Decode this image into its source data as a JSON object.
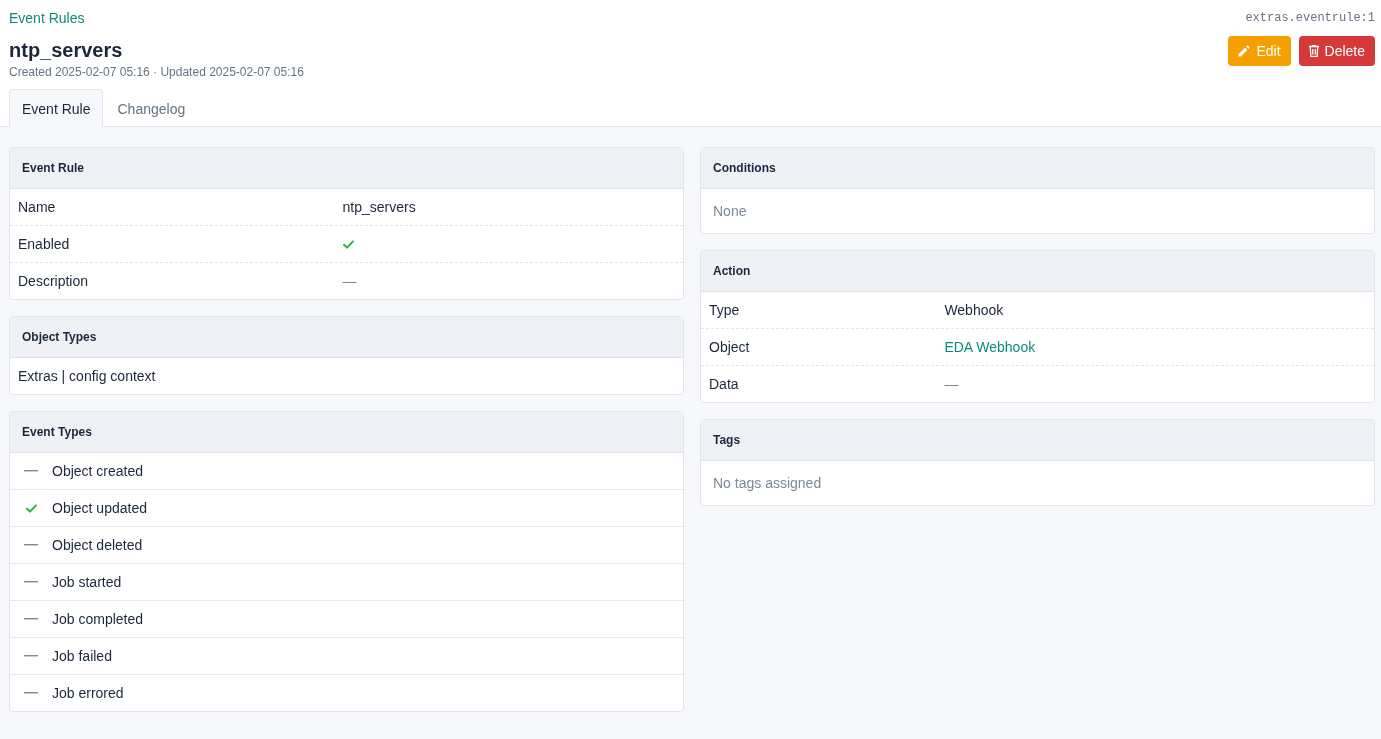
{
  "breadcrumb": {
    "label": "Event Rules"
  },
  "object_id": "extras.eventrule:1",
  "title": "ntp_servers",
  "subtitle": "Created 2025-02-07 05:16 · Updated 2025-02-07 05:16",
  "buttons": [
    {
      "label": "Edit",
      "kind": "edit"
    },
    {
      "label": "Delete",
      "kind": "delete"
    }
  ],
  "tabs": [
    {
      "label": "Event Rule",
      "selected": true
    },
    {
      "label": "Changelog",
      "selected": false
    }
  ],
  "columns": [
    {
      "cards": [
        {
          "title": "Event Rule",
          "kind": "attributes",
          "rows": [
            {
              "label": "Name",
              "kind": "text",
              "value": "ntp_servers"
            },
            {
              "label": "Enabled",
              "kind": "boolean",
              "checked": true
            },
            {
              "label": "Description",
              "kind": "placeholder",
              "value": "—"
            }
          ]
        },
        {
          "title": "Object Types",
          "kind": "text",
          "text": "Extras | config context"
        },
        {
          "title": "Event Types",
          "kind": "checklist",
          "items": [
            {
              "label": "Object created",
              "checked": false
            },
            {
              "label": "Object updated",
              "checked": true
            },
            {
              "label": "Object deleted",
              "checked": false
            },
            {
              "label": "Job started",
              "checked": false
            },
            {
              "label": "Job completed",
              "checked": false
            },
            {
              "label": "Job failed",
              "checked": false
            },
            {
              "label": "Job errored",
              "checked": false
            }
          ]
        }
      ]
    },
    {
      "cards": [
        {
          "title": "Conditions",
          "kind": "muted",
          "text": "None"
        },
        {
          "title": "Action",
          "kind": "attributes",
          "rows": [
            {
              "label": "Type",
              "kind": "text",
              "value": "Webhook"
            },
            {
              "label": "Object",
              "kind": "link",
              "value": "EDA Webhook"
            },
            {
              "label": "Data",
              "kind": "placeholder",
              "value": "—"
            }
          ]
        },
        {
          "title": "Tags",
          "kind": "muted",
          "text": "No tags assigned"
        }
      ]
    }
  ]
}
